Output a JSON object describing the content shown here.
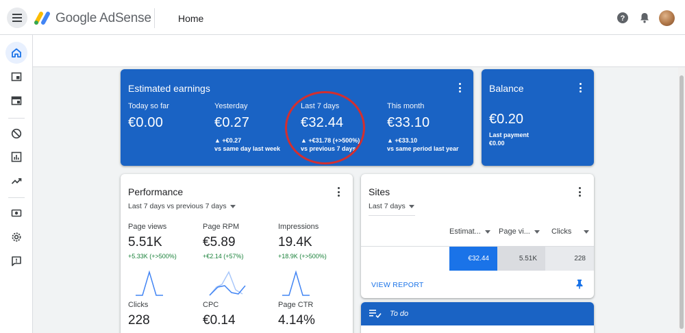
{
  "header": {
    "brand": "Google AdSense",
    "page_title": "Home"
  },
  "colors": {
    "accent_blue": "#1a63c4",
    "positive_green": "#188038",
    "annotation_red": "#d32f2f"
  },
  "earnings": {
    "title": "Estimated earnings",
    "metrics": [
      {
        "label": "Today so far",
        "value": "€0.00",
        "delta": "",
        "vs": ""
      },
      {
        "label": "Yesterday",
        "value": "€0.27",
        "delta": "▲ +€0.27",
        "vs": "vs same day last week"
      },
      {
        "label": "Last 7 days",
        "value": "€32.44",
        "delta": "▲ +€31.78 (+>500%)",
        "vs": "vs previous 7 days"
      },
      {
        "label": "This month",
        "value": "€33.10",
        "delta": "▲ +€33.10",
        "vs": "vs same period last year"
      }
    ]
  },
  "balance": {
    "title": "Balance",
    "value": "€0.20",
    "last_payment_label": "Last payment",
    "last_payment_value": "€0.00"
  },
  "performance": {
    "title": "Performance",
    "range": "Last 7 days vs previous 7 days",
    "metrics": [
      {
        "label": "Page views",
        "value": "5.51K",
        "delta": "+5.33K (+>500%)"
      },
      {
        "label": "Page RPM",
        "value": "€5.89",
        "delta": "+€2.14 (+57%)"
      },
      {
        "label": "Impressions",
        "value": "19.4K",
        "delta": "+18.9K (+>500%)"
      },
      {
        "label": "Clicks",
        "value": "228",
        "delta": ""
      },
      {
        "label": "CPC",
        "value": "€0.14",
        "delta": ""
      },
      {
        "label": "Page CTR",
        "value": "4.14%",
        "delta": ""
      }
    ]
  },
  "sites": {
    "title": "Sites",
    "range": "Last 7 days",
    "columns": [
      "Estimat...",
      "Page vi...",
      "Clicks"
    ],
    "row": [
      "€32.44",
      "5.51K",
      "228"
    ],
    "view_report": "VIEW REPORT"
  },
  "todo": {
    "title": "To do"
  },
  "rail_icons": [
    "home-icon",
    "ads-icon",
    "sites-icon",
    "block-icon",
    "reports-icon",
    "optimization-icon",
    "payments-icon",
    "settings-icon",
    "feedback-icon"
  ]
}
